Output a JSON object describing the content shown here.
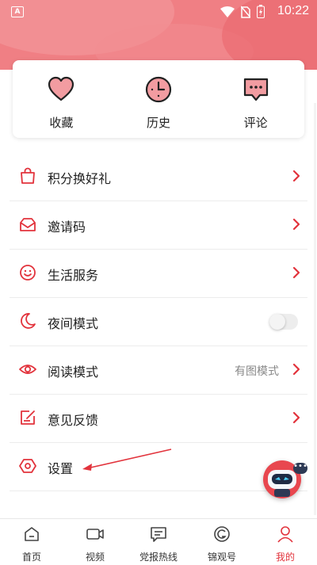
{
  "status_bar": {
    "time": "10:22",
    "notification_badge": "A"
  },
  "quick_actions": [
    {
      "label": "收藏",
      "icon": "heart-icon"
    },
    {
      "label": "历史",
      "icon": "clock-icon"
    },
    {
      "label": "评论",
      "icon": "comment-icon"
    }
  ],
  "menu": [
    {
      "label": "积分换好礼",
      "icon": "shopping-bag-icon"
    },
    {
      "label": "邀请码",
      "icon": "inbox-icon"
    },
    {
      "label": "生活服务",
      "icon": "smile-icon"
    },
    {
      "label": "夜间模式",
      "icon": "moon-icon",
      "toggle_on": false
    },
    {
      "label": "阅读模式",
      "icon": "eye-icon",
      "value": "有图模式"
    },
    {
      "label": "意见反馈",
      "icon": "feedback-icon"
    },
    {
      "label": "设置",
      "icon": "hexagon-settings-icon"
    }
  ],
  "tabs": [
    {
      "label": "首页",
      "icon": "home-icon"
    },
    {
      "label": "视频",
      "icon": "video-icon"
    },
    {
      "label": "党报热线",
      "icon": "message-icon"
    },
    {
      "label": "锦观号",
      "icon": "circle-g-icon"
    },
    {
      "label": "我的",
      "icon": "person-icon",
      "active": true
    }
  ],
  "colors": {
    "accent": "#e2333c",
    "header": "#f07f84"
  }
}
